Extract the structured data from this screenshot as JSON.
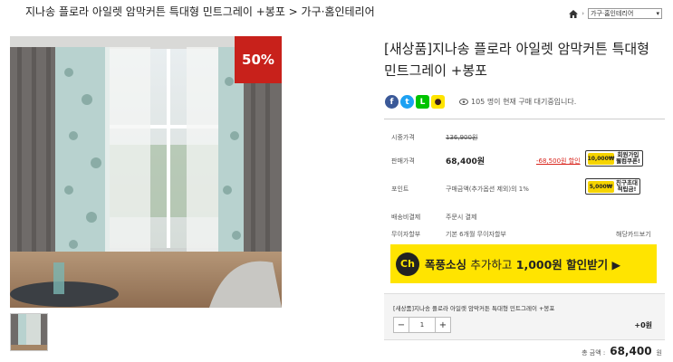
{
  "breadcrumb": {
    "text": "지나송 플로라 아일렛 암막커튼 특대형 민트그레이 +봉포 > 가구·홈인테리어"
  },
  "nav": {
    "category": "가구·홈인테리어"
  },
  "product": {
    "badge": "50%",
    "title": "[새상품]지나송 플로라 아일렛 암막커튼 특대형 민트그레이 +봉포"
  },
  "share": {
    "viewers": "105 명이 현재 구매 대기중입니다."
  },
  "info": {
    "regular_label": "시중가격",
    "regular_value": "136,900원",
    "sale_label": "판매가격",
    "sale_value": "68,400원",
    "discount": "-68,500원 할인",
    "point_label": "포인트",
    "point_value": "구매금액(추가옵션 제외)의 1%",
    "pay_label": "배송비결제",
    "pay_value": "주문시 결제",
    "installment_label": "무이자할부",
    "installment_value": "기본 6개월 무이자할부",
    "card_link": "해당카드보기"
  },
  "coupons": {
    "coin1": "10,000₩",
    "text1": "회원가입\n웰컴쿠폰!",
    "coin2": "5,000₩",
    "text2": "친구초대\n적립금!"
  },
  "banner": {
    "logo": "Ch",
    "strong1": "폭풍소싱",
    "light": "추가하고",
    "strong2": "1,000원 할인받기 ▶"
  },
  "option": {
    "name": "[새상품]지나송 플로라 아일렛 암막커튼 특대형 민트그레이 +봉포",
    "minus": "−",
    "qty": "1",
    "plus": "+",
    "price": "+0원"
  },
  "total": {
    "label": "총 금액 :",
    "value": "68,400",
    "unit": "원"
  },
  "colors": {
    "badge": "#c8211b",
    "banner": "#ffe400",
    "discount": "#d9251d"
  }
}
